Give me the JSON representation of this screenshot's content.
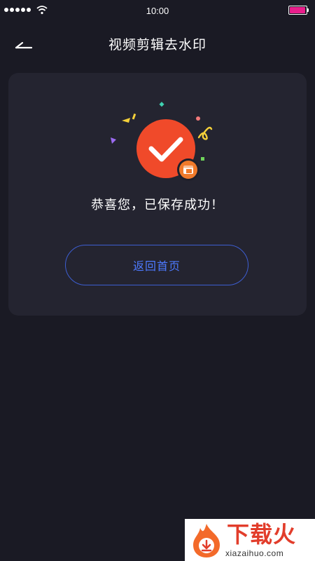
{
  "status_bar": {
    "time": "10:00",
    "battery_color": "#e91e8c"
  },
  "nav": {
    "title": "视频剪辑去水印",
    "back_icon": "arrow-left-icon"
  },
  "result": {
    "icon": "success-check-icon",
    "message": "恭喜您，已保存成功！",
    "home_button_label": "返回首页"
  },
  "colors": {
    "background": "#1a1a24",
    "card": "#242430",
    "accent_blue": "#4d7aff",
    "success_red": "#f04a2a",
    "badge_orange": "#f07a2a"
  },
  "watermark": {
    "brand": "下载火",
    "domain": "xiazaihuo.com"
  }
}
